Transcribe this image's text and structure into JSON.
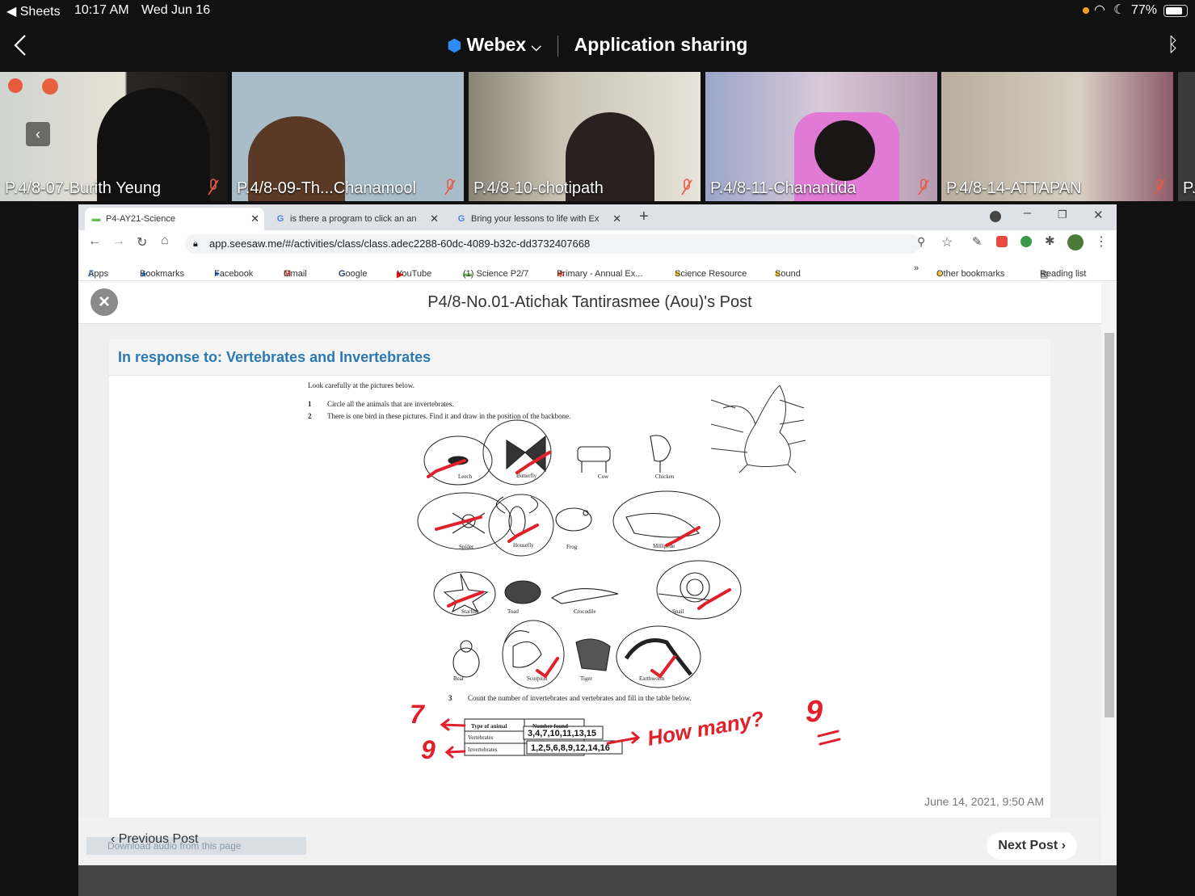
{
  "status": {
    "back_app": "Sheets",
    "time": "10:17 AM",
    "date": "Wed Jun 16",
    "battery": "77%"
  },
  "webex": {
    "app": "Webex",
    "mode": "Application sharing"
  },
  "participants": [
    {
      "name": "P.4/8-07-Burith Yeung"
    },
    {
      "name": "P.4/8-09-Th...Chanamool"
    },
    {
      "name": "P.4/8-10-chotipath"
    },
    {
      "name": "P.4/8-11-Chanantida"
    },
    {
      "name": "P.4/8-14-ATTAPAN"
    },
    {
      "name": "P."
    }
  ],
  "browser": {
    "tabs": [
      {
        "label": "P4-AY21-Science"
      },
      {
        "label": "is there a program to click an an"
      },
      {
        "label": "Bring your lessons to life with Ex"
      }
    ],
    "url": "app.seesaw.me/#/activities/class/class.adec2288-60dc-4089-b32c-dd3732407668",
    "bookmarks": [
      "Apps",
      "Bookmarks",
      "Facebook",
      "Gmail",
      "Google",
      "YouTube",
      "(1) Science P2/7",
      "Primary - Annual Ex...",
      "Science Resource",
      "Sound",
      "»",
      "Other bookmarks",
      "Reading list"
    ]
  },
  "post": {
    "title": "P4/8-No.01-Atichak Tantirasmee (Aou)'s Post",
    "response": "In response to: Vertebrates and Invertebrates",
    "date": "June 14, 2021, 9:50 AM",
    "prev": "Previous Post",
    "next": "Next Post",
    "download_bar": "Download audio from this page"
  },
  "worksheet": {
    "intro": "Look carefully at the pictures below.",
    "q1_num": "1",
    "q1": "Circle all the animals that are invertebrates.",
    "q2_num": "2",
    "q2": "There is one bird in these pictures. Find it and draw in the position of the backbone.",
    "q3_num": "3",
    "q3": "Count the number of invertebrates and vertebrates and fill in the table below.",
    "animals": [
      "Leech",
      "Butterfly",
      "Cow",
      "Chicken",
      "Spider",
      "Housefly",
      "Frog",
      "Millipede",
      "Starfish",
      "Toad",
      "Crocodile",
      "Snail",
      "Bear",
      "Scorpion",
      "Tiger",
      "Earthworm"
    ],
    "table_headers": [
      "Type of animal",
      "Number found"
    ],
    "table_rows": [
      "Vertebrates",
      "Invertebrates"
    ],
    "vert_answer": "3,4,7,10,11,13,15",
    "invert_answer": "1,2,5,6,8,9,12,14,16",
    "hw_7": "7",
    "hw_9": "9",
    "hw_question": "How many?",
    "hw_answer": "9"
  }
}
